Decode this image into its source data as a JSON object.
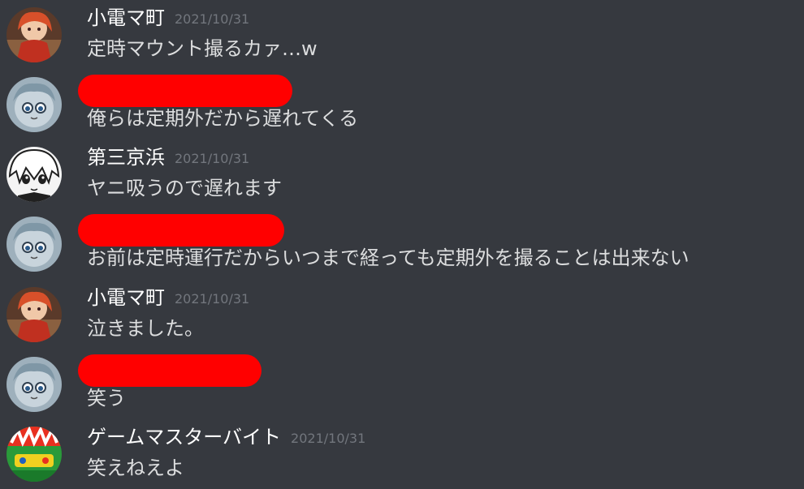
{
  "colors": {
    "background": "#36393f",
    "username": "#ffffff",
    "message_text": "#dcddde",
    "timestamp": "#72767d",
    "redaction": "#ff0000"
  },
  "messages": [
    {
      "username": "小電マ町",
      "timestamp": "2021/10/31",
      "text": "定時マウント撮るカァ…w",
      "avatar": "anime-girl-red-avatar"
    },
    {
      "username": "",
      "timestamp": "",
      "text": "俺らは定期外だから遅れてくる",
      "avatar": "anime-character-blue-avatar",
      "redacted": true
    },
    {
      "username": "第三京浜",
      "timestamp": "2021/10/31",
      "text": "ヤニ吸うので遅れます",
      "avatar": "anime-character-monochrome-avatar"
    },
    {
      "username": "",
      "timestamp": "",
      "text": "お前は定時運行だからいつまで経っても定期外を撮ることは出来ない",
      "avatar": "anime-character-blue-avatar",
      "redacted": true
    },
    {
      "username": "小電マ町",
      "timestamp": "2021/10/31",
      "text": "泣きました。",
      "avatar": "anime-girl-red-avatar"
    },
    {
      "username": "",
      "timestamp": "",
      "text": "笑う",
      "avatar": "anime-character-blue-avatar",
      "redacted": true
    },
    {
      "username": "ゲームマスターバイト",
      "timestamp": "2021/10/31",
      "text": "笑えねえよ",
      "avatar": "colorful-logo-avatar"
    }
  ]
}
